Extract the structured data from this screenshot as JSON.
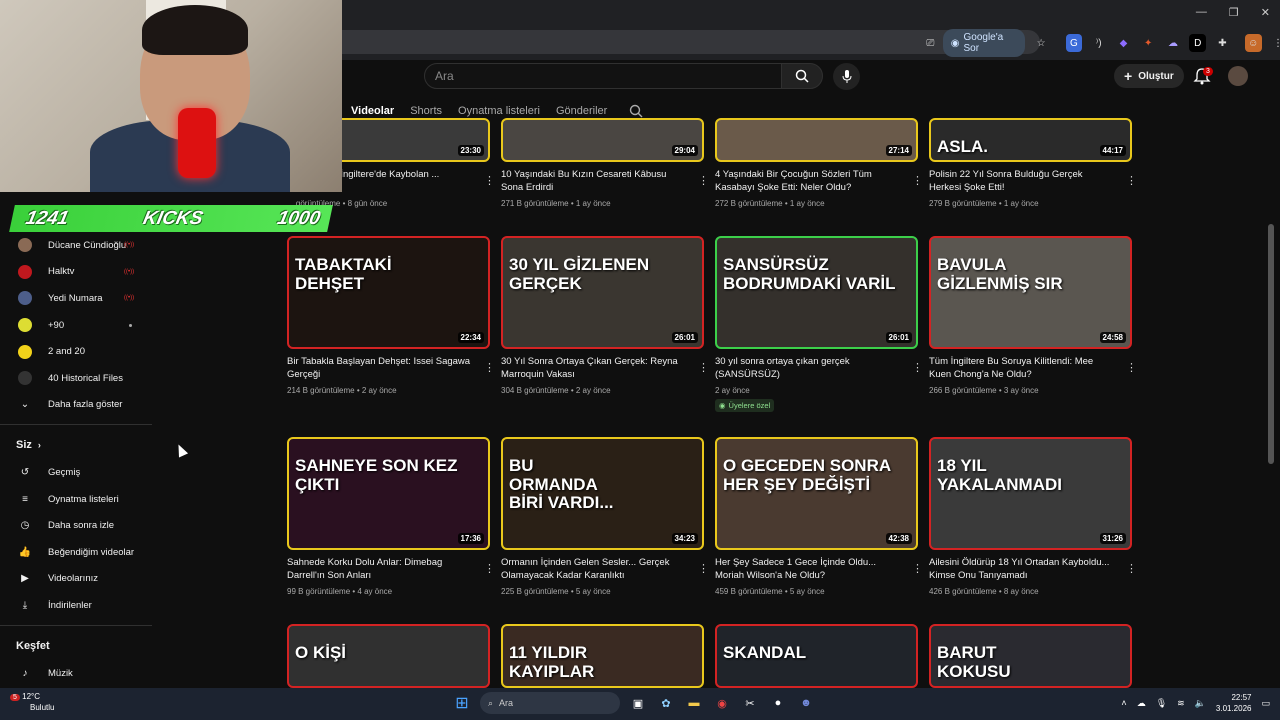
{
  "browser": {
    "google_sor": "Google'a Sor",
    "bell_count": "3",
    "create_label": "Oluştur"
  },
  "search": {
    "placeholder": "Ara"
  },
  "tabs": [
    "Videolar",
    "Shorts",
    "Oynatma listeleri",
    "Gönderiler"
  ],
  "overlay": {
    "kicks_left": "1241",
    "kicks_label": "KICKS",
    "kicks_right": "1000"
  },
  "sidebar": {
    "subs": [
      {
        "label": "Dücane Cündioğlu",
        "kind": "live",
        "color": "#8a6a55"
      },
      {
        "label": "Halktv",
        "kind": "live",
        "color": "#c0181e"
      },
      {
        "label": "Yedi Numara",
        "kind": "live",
        "color": "#4d5e8a"
      },
      {
        "label": "+90",
        "kind": "dot",
        "color": "#dddd33"
      },
      {
        "label": "2 and 20",
        "kind": "none",
        "color": "#f2d21a"
      },
      {
        "label": "40 Historical Files",
        "kind": "none",
        "color": "#333333"
      }
    ],
    "more": "Daha fazla göster",
    "you_section": "Siz",
    "you_items": [
      {
        "label": "Geçmiş",
        "icon": "history-icon"
      },
      {
        "label": "Oynatma listeleri",
        "icon": "playlists-icon"
      },
      {
        "label": "Daha sonra izle",
        "icon": "watch-later-icon"
      },
      {
        "label": "Beğendiğim videolar",
        "icon": "liked-icon"
      },
      {
        "label": "Videolarınız",
        "icon": "your-videos-icon"
      },
      {
        "label": "İndirilenler",
        "icon": "downloads-icon"
      }
    ],
    "explore_section": "Keşfet",
    "explore_items": [
      {
        "label": "Müzik",
        "icon": "music-icon"
      }
    ]
  },
  "videos_row0": [
    {
      "title": "... Ne Oldu? İngiltere'de Kaybolan ...",
      "meta": "... görüntüleme • 8 gün önce",
      "dur": "23:30",
      "border": "yellow",
      "bg": "#3a3a3a",
      "thumb_title": ""
    },
    {
      "title": "10 Yaşındaki Bu Kızın Cesareti Kâbusu Sona Erdirdi",
      "meta": "271 B görüntüleme • 1 ay önce",
      "dur": "29:04",
      "border": "yellow",
      "bg": "#4a4642",
      "thumb_title": ""
    },
    {
      "title": "4 Yaşındaki Bir Çocuğun Sözleri Tüm Kasabayı Şoke Etti: Neler Oldu?",
      "meta": "272 B görüntüleme • 1 ay önce",
      "dur": "27:14",
      "border": "yellow",
      "bg": "#6a5a4a",
      "thumb_title": ""
    },
    {
      "title": "Polisin 22 Yıl Sonra Bulduğu Gerçek Herkesi Şoke Etti!",
      "meta": "279 B görüntüleme • 1 ay önce",
      "dur": "44:17",
      "border": "yellow",
      "bg": "#2a2a2a",
      "thumb_title": "ASLA."
    }
  ],
  "videos_row1": [
    {
      "title": "Bir Tabakla Başlayan Dehşet: Issei Sagawa Gerçeği",
      "meta": "214 B görüntüleme • 2 ay önce",
      "dur": "22:34",
      "border": "red",
      "bg": "#1c1410",
      "thumb_title": "TABAKTAKİ\nDEHŞET",
      "members": ""
    },
    {
      "title": "30 Yıl Sonra Ortaya Çıkan Gerçek: Reyna Marroquin Vakası",
      "meta": "304 B görüntüleme • 2 ay önce",
      "dur": "26:01",
      "border": "red",
      "bg": "#3a3630",
      "thumb_title": "30 YIL GİZLENEN\nGERÇEK",
      "members": ""
    },
    {
      "title": "30 yıl sonra ortaya çıkan gerçek (SANSÜRSÜZ)",
      "meta": "2 ay önce",
      "dur": "26:01",
      "border": "green",
      "bg": "#34302c",
      "thumb_title": "SANSÜRSÜZ\nBODRUMDAKİ VARİL",
      "members": "Üyelere özel"
    },
    {
      "title": "Tüm İngiltere Bu Soruya Kilitlendi: Mee Kuen Chong'a Ne Oldu?",
      "meta": "266 B görüntüleme • 3 ay önce",
      "dur": "24:58",
      "border": "red",
      "bg": "#5a5650",
      "thumb_title": "BAVULA\nGİZLENMİŞ SIR",
      "members": ""
    }
  ],
  "videos_row2": [
    {
      "title": "Sahnede Korku Dolu Anlar: Dimebag Darrell'ın Son Anları",
      "meta": "99 B görüntüleme • 4 ay önce",
      "dur": "17:36",
      "border": "yellow",
      "bg": "#2a1020",
      "thumb_title": "SAHNEYE SON KEZ\nÇIKTI"
    },
    {
      "title": "Ormanın İçinden Gelen Sesler... Gerçek Olamayacak Kadar Karanlıktı",
      "meta": "225 B görüntüleme • 5 ay önce",
      "dur": "34:23",
      "border": "yellow",
      "bg": "#2a2016",
      "thumb_title": "BU\nORMANDA\nBİRİ VARDI..."
    },
    {
      "title": "Her Şey Sadece 1 Gece İçinde Oldu... Moriah Wilson'a Ne Oldu?",
      "meta": "459 B görüntüleme • 5 ay önce",
      "dur": "42:38",
      "border": "yellow",
      "bg": "#4a3a30",
      "thumb_title": "O GECEDEN SONRA\nHER ŞEY DEĞİŞTİ"
    },
    {
      "title": "Ailesini Öldürüp 18 Yıl Ortadan Kayboldu... Kimse Onu Tanıyamadı",
      "meta": "426 B görüntüleme • 8 ay önce",
      "dur": "31:26",
      "border": "red",
      "bg": "#3a3a3a",
      "thumb_title": "18 YIL\nYAKALANMADI"
    }
  ],
  "videos_row3": [
    {
      "border": "red",
      "bg": "#303030",
      "thumb_title": "O KİŞİ"
    },
    {
      "border": "yellow",
      "bg": "#3a2a22",
      "thumb_title": "11 YILDIR\nKAYIPLAR"
    },
    {
      "border": "red",
      "bg": "#20242a",
      "thumb_title": "SKANDAL"
    },
    {
      "border": "red",
      "bg": "#2a2a30",
      "thumb_title": "BARUT\nKOKUSU"
    }
  ],
  "taskbar": {
    "weather_temp": "12°C",
    "weather_desc": "Bulutlu",
    "weather_badge": "5",
    "search": "Ara",
    "time": "22:57",
    "date": "3.01.2026"
  }
}
